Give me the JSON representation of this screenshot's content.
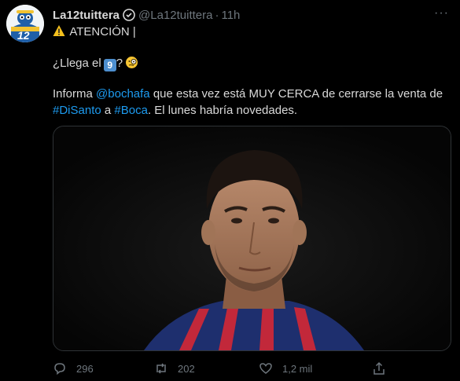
{
  "tweet": {
    "display_name": "La12tuittera",
    "handle": "@La12tuittera",
    "separator": "·",
    "time": "11h",
    "line1": {
      "text": "ATENCIÓN |"
    },
    "line2": {
      "prefix": "¿Llega el",
      "badge": "9",
      "suffix": "?"
    },
    "line3": {
      "prefix": "Informa",
      "mention": "@bochafa",
      "suffix": "que esta vez está MUY CERCA de cerrarse la venta de"
    },
    "line4": {
      "hashtag1": "#DiSanto",
      "conj": "a",
      "hashtag2": "#Boca",
      "suffix": ". El lunes habría novedades."
    },
    "avatar_badge": "12"
  },
  "actions": {
    "replies": "296",
    "retweets": "202",
    "likes": "1,2 mil"
  },
  "colors": {
    "background": "#000000",
    "text": "#d9d9d9",
    "muted": "#6e767d",
    "link": "#1d9bf0",
    "border": "#2f3336"
  },
  "icons": [
    "verified-icon",
    "more-icon",
    "warning-icon",
    "keycap-nine-icon",
    "monocle-face-icon",
    "reply-icon",
    "retweet-icon",
    "like-icon",
    "share-icon"
  ]
}
